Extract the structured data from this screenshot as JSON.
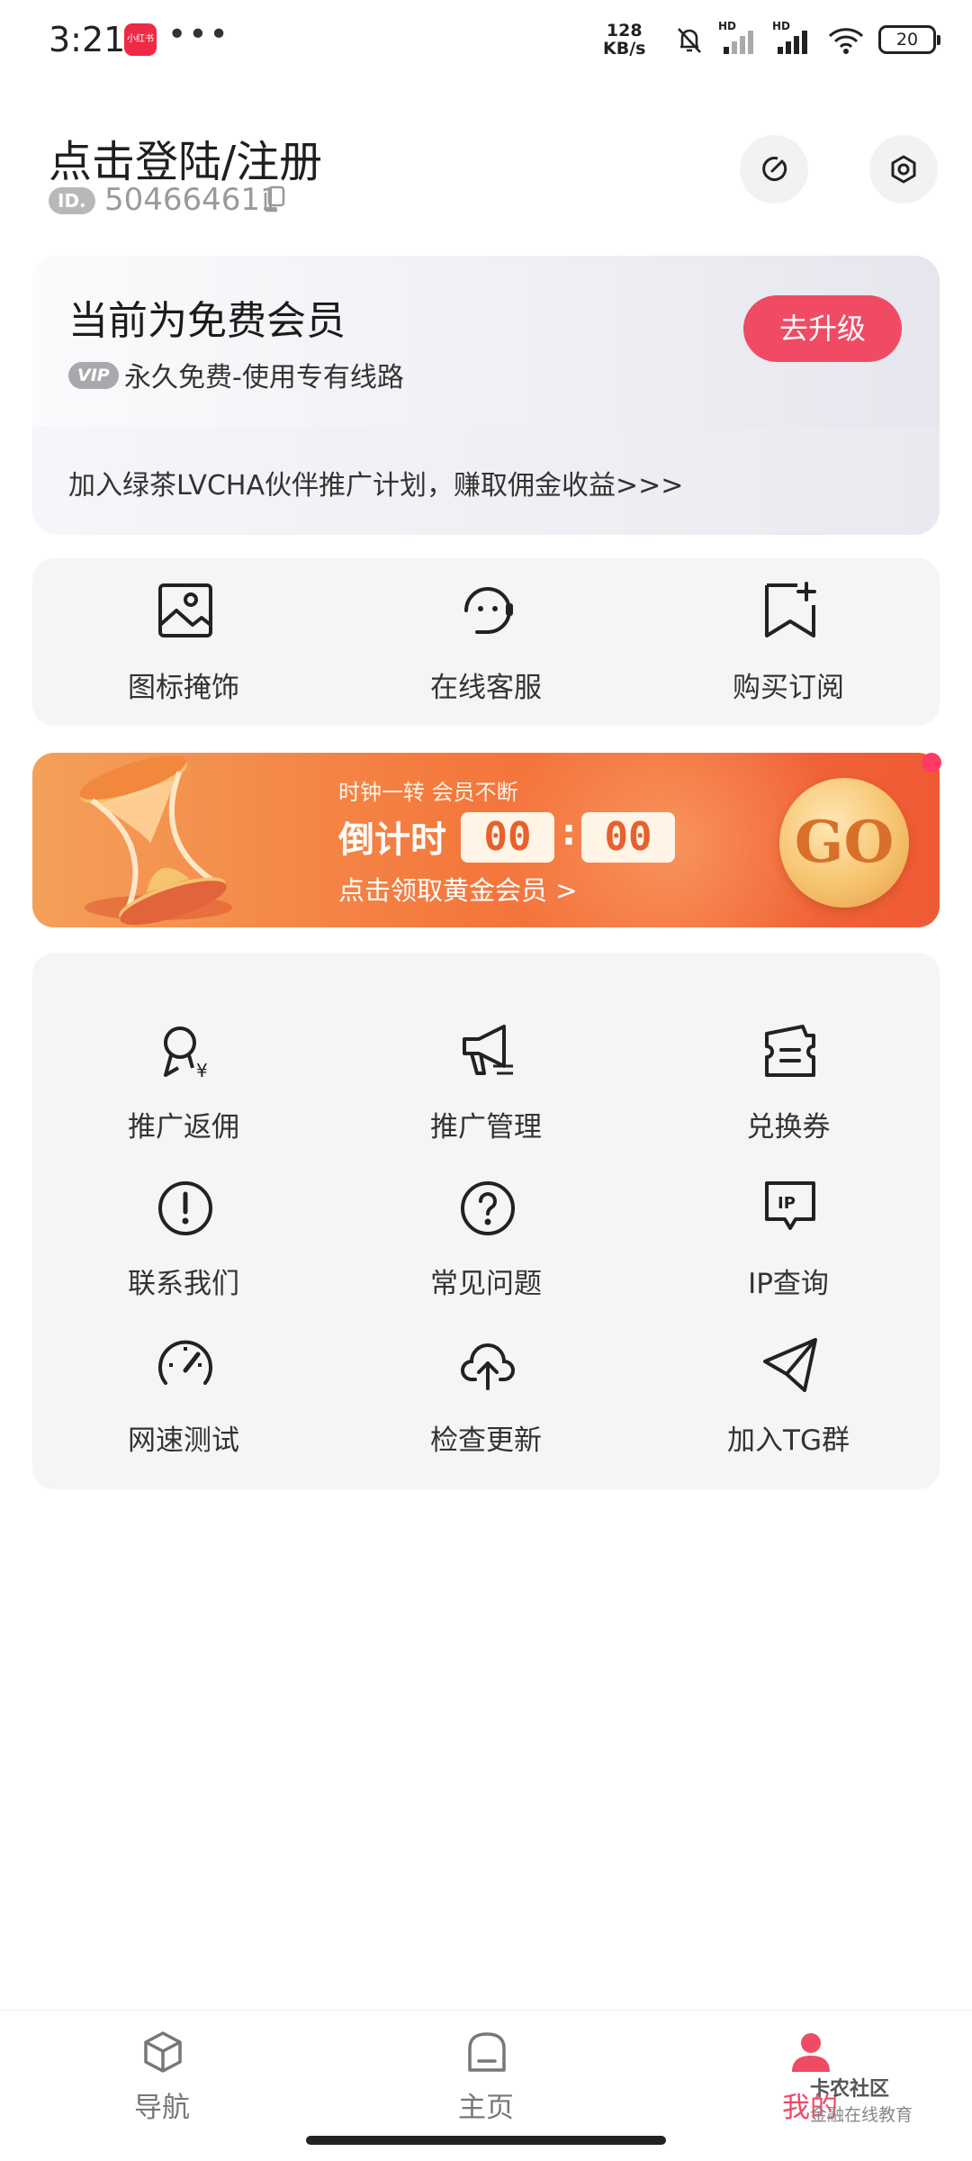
{
  "status_bar": {
    "time": "3:21",
    "app_badge": "小红书",
    "dots": "•••",
    "speed_value": "128",
    "speed_unit": "KB/s",
    "network_label_1": "HD",
    "network_label_2": "HD",
    "battery": "20"
  },
  "header": {
    "title": "点击登陆/注册",
    "id_badge": "ID.",
    "id_number": "504664611"
  },
  "member_card": {
    "title": "当前为免费会员",
    "vip_badge": "VIP",
    "subtitle": "永久免费-使用专有线路",
    "upgrade_button": "去升级",
    "promo_text": "加入绿茶LVCHA伙伴推广计划，赚取佣金收益>>>"
  },
  "quick_actions": [
    {
      "label": "图标掩饰",
      "icon": "image-icon"
    },
    {
      "label": "在线客服",
      "icon": "customer-service-icon"
    },
    {
      "label": "购买订阅",
      "icon": "bookmark-add-icon"
    }
  ],
  "banner": {
    "small_text": "时钟一转 会员不断",
    "countdown_label": "倒计时",
    "minutes": "00",
    "colon": ":",
    "seconds": "00",
    "link_text": "点击领取黄金会员 >",
    "go_text": "GO"
  },
  "grid_items": [
    {
      "label": "推广返佣",
      "icon": "commission-icon"
    },
    {
      "label": "推广管理",
      "icon": "megaphone-icon"
    },
    {
      "label": "兑换券",
      "icon": "ticket-icon"
    },
    {
      "label": "联系我们",
      "icon": "exclamation-icon"
    },
    {
      "label": "常见问题",
      "icon": "question-icon"
    },
    {
      "label": "IP查询",
      "icon": "ip-icon"
    },
    {
      "label": "网速测试",
      "icon": "speedometer-icon"
    },
    {
      "label": "检查更新",
      "icon": "cloud-upload-icon"
    },
    {
      "label": "加入TG群",
      "icon": "telegram-icon"
    }
  ],
  "bottom_nav": [
    {
      "label": "导航",
      "icon": "cube-icon"
    },
    {
      "label": "主页",
      "icon": "home-icon"
    },
    {
      "label": "我的",
      "icon": "user-icon",
      "active": true
    }
  ],
  "watermark": {
    "brand": "卡农社区",
    "tagline": "金融在线教育"
  },
  "colors": {
    "accent": "#f04a64",
    "banner_start": "#f4a05a",
    "banner_end": "#ef5a35"
  }
}
